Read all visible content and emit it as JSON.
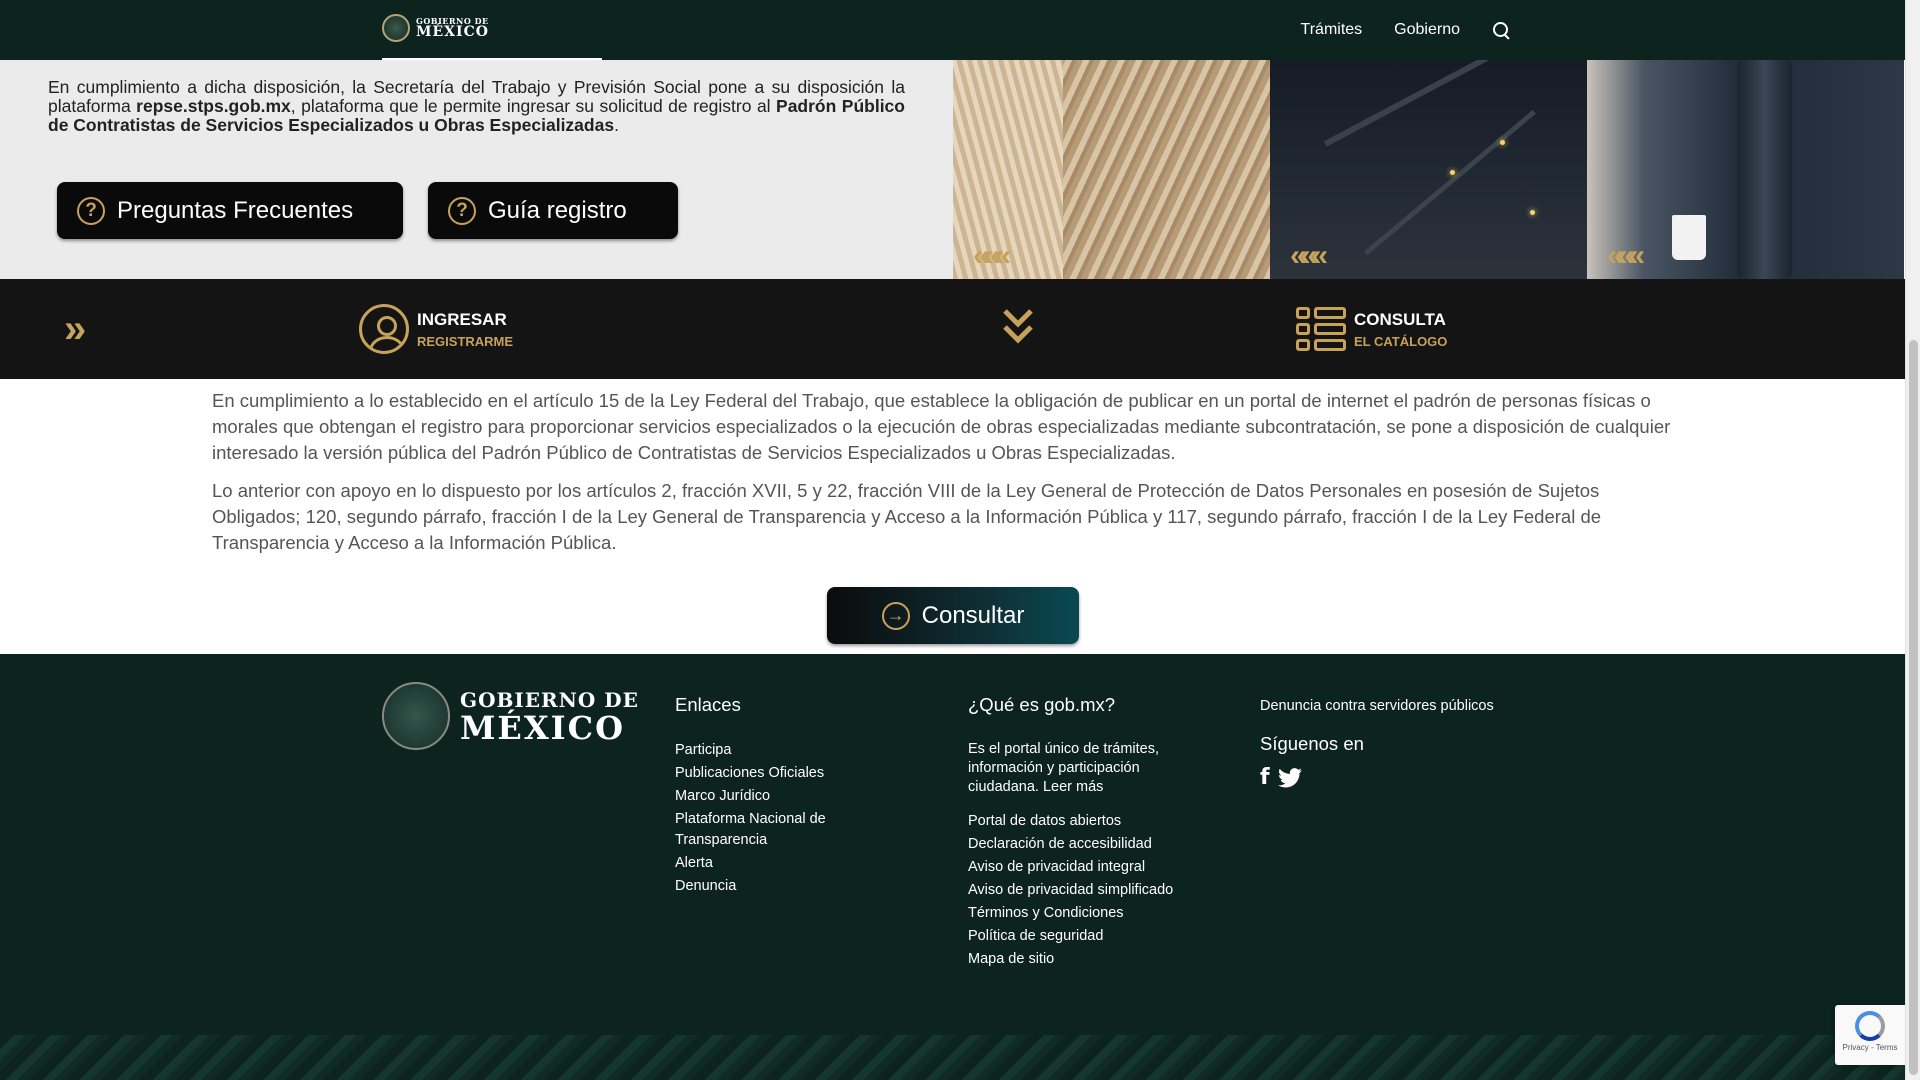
{
  "navbar": {
    "logo_line1": "GOBIERNO DE",
    "logo_line2": "MÉXICO",
    "links": [
      "Trámites",
      "Gobierno"
    ]
  },
  "hero": {
    "text_part1": "En cumplimiento a dicha disposición, la Secretaría del Trabajo y Previsión Social pone a su disposición la plataforma ",
    "text_bold1": "repse.stps.gob.mx",
    "text_part2": ", plataforma que le permite ingresar su solicitud de registro al ",
    "text_bold2": "Padrón Público de Contratistas de Servicios Especializados u Obras Especializadas",
    "text_part3": ".",
    "faq_button": "Preguntas Frecuentes",
    "guide_button": "Guía registro",
    "question_glyph": "?",
    "chevrons": "«««"
  },
  "actionbar": {
    "arrow_glyph": "»",
    "down_glyph": "⌄⌄",
    "ingresar_title": "INGRESAR",
    "ingresar_sub": "REGISTRARME",
    "consulta_title": "CONSULTA",
    "consulta_sub": "EL CATÁLOGO"
  },
  "content": {
    "paragraph1": "En cumplimiento a lo establecido en el artículo 15 de la Ley Federal del Trabajo, que establece la obligación de publicar en un portal de internet el padrón de personas físicas o morales que obtengan el registro para proporcionar servicios especializados o la ejecución de obras especializadas mediante subcontratación, se pone a disposición de cualquier interesado la versión pública del Padrón Público de Contratistas de Servicios Especializados u Obras Especializadas.",
    "paragraph2": "Lo anterior con apoyo en lo dispuesto por los artículos 2, fracción XVII, 5 y 22, fracción VIII de la Ley General de Protección de Datos Personales en posesión de Sujetos Obligados; 120, segundo párrafo, fracción I de la Ley General de Transparencia y Acceso a la Información Pública y 117, segundo párrafo, fracción I de la Ley Federal de Transparencia y Acceso a la Información Pública.",
    "consult_button": "Consultar",
    "arrow_glyph": "→"
  },
  "footer": {
    "logo_line1": "GOBIERNO DE",
    "logo_line2": "MÉXICO",
    "enlaces_title": "Enlaces",
    "enlaces": [
      "Participa",
      "Publicaciones Oficiales",
      "Marco Jurídico",
      "Plataforma Nacional de Transparencia",
      "Alerta",
      "Denuncia"
    ],
    "que_es_title": "¿Qué es gob.mx?",
    "que_es_text": "Es el portal único de trámites, información y participación ciudadana. Leer más",
    "que_es_links": [
      "Portal de datos abiertos",
      "Declaración de accesibilidad",
      "Aviso de privacidad integral",
      "Aviso de privacidad simplificado",
      "Términos y Condiciones",
      "Política de seguridad",
      "Mapa de sitio"
    ],
    "denuncia_link": "Denuncia contra servidores públicos",
    "siguenos_title": "Síguenos en",
    "facebook_glyph": "f"
  },
  "recaptcha": {
    "text": "Privacy - Terms"
  },
  "colors": {
    "accent_gold": "#c6a25b",
    "footer_green": "#0c231e",
    "action_bar": "#141414"
  }
}
